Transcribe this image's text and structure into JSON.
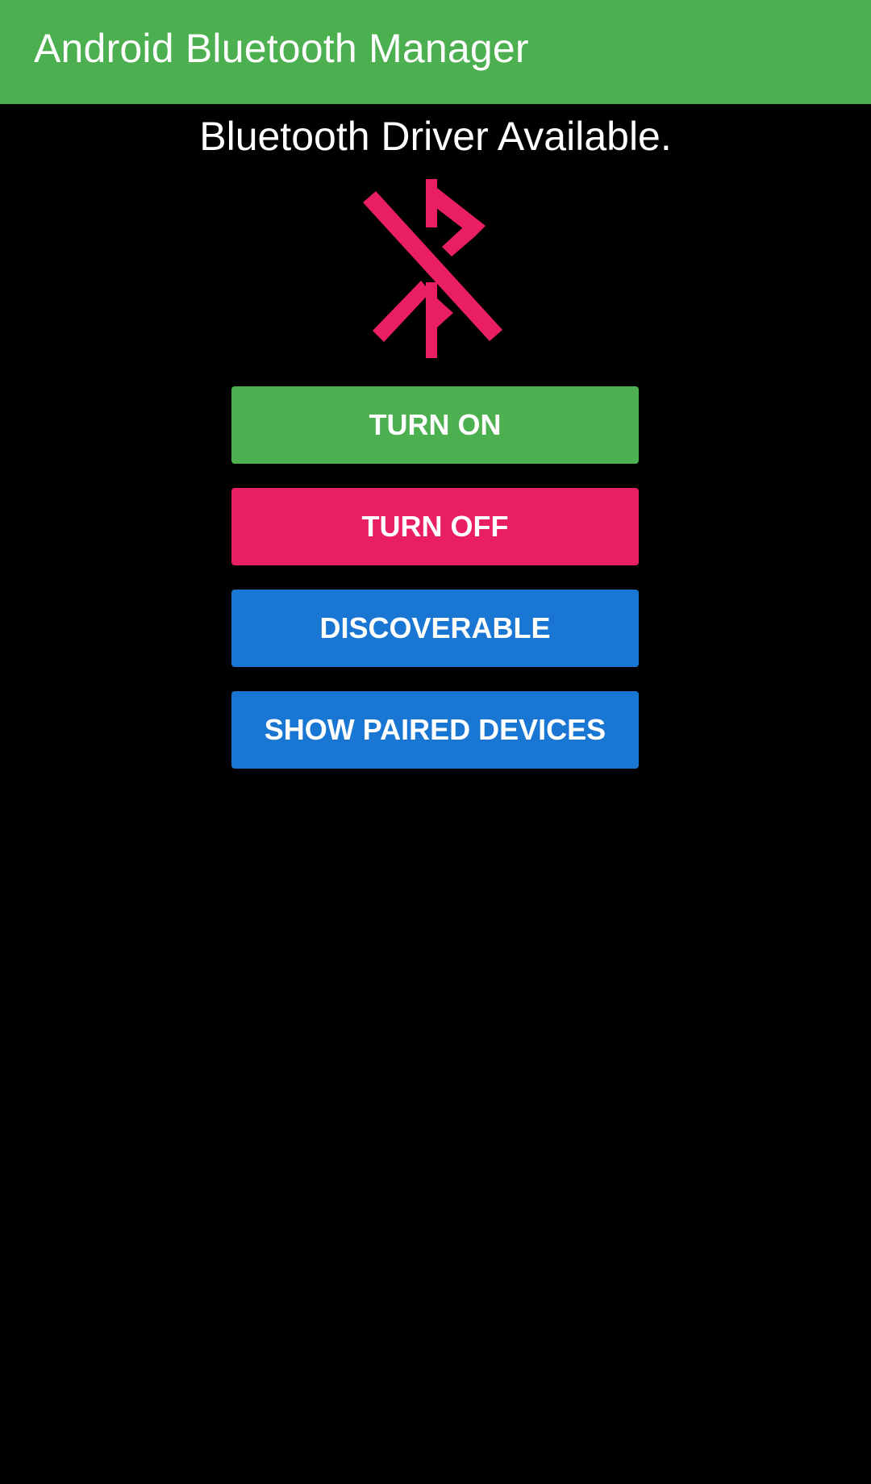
{
  "app_bar": {
    "title": "Android Bluetooth Manager",
    "color": "#4CAF50"
  },
  "status": {
    "text": "Bluetooth Driver Available."
  },
  "icon": {
    "name": "bluetooth-disabled-icon",
    "color": "#E91E63"
  },
  "buttons": {
    "turn_on": {
      "label": "TURN ON",
      "color": "#4CAF50"
    },
    "turn_off": {
      "label": "TURN OFF",
      "color": "#E91E63"
    },
    "discoverable": {
      "label": "DISCOVERABLE",
      "color": "#1976D2"
    },
    "show_paired": {
      "label": "SHOW PAIRED DEVICES",
      "color": "#1976D2"
    }
  },
  "background_color": "#000000"
}
